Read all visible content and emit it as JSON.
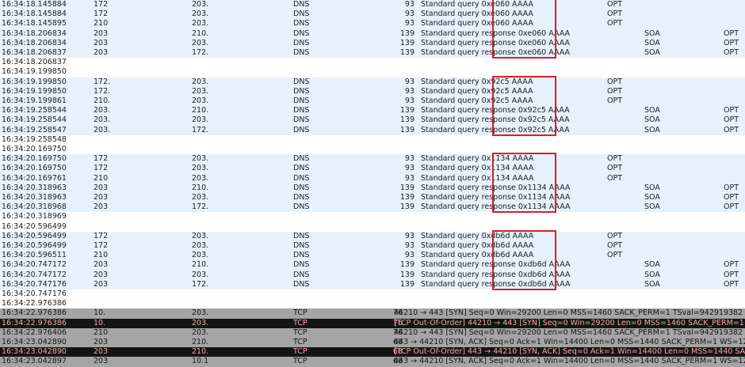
{
  "rows": [
    {
      "time": "16:34:18.145884",
      "src": "172",
      "dst": "203.",
      "proto": "DNS",
      "len": "93",
      "info": "Standard query 0xe060 AAAA",
      "rr1": "OPT",
      "rr2": "",
      "rr3": "",
      "style": "dns"
    },
    {
      "time": "16:34:18.145884",
      "src": "172",
      "dst": "203.",
      "proto": "DNS",
      "len": "93",
      "info": "Standard query 0xe060 AAAA",
      "rr1": "OPT",
      "rr2": "",
      "rr3": "",
      "style": "dns"
    },
    {
      "time": "16:34:18.145895",
      "src": "210",
      "dst": "203.",
      "proto": "DNS",
      "len": "93",
      "info": "Standard query 0xe060 AAAA",
      "rr1": "OPT",
      "rr2": "",
      "rr3": "",
      "style": "dns"
    },
    {
      "time": "16:34:18.206834",
      "src": "203",
      "dst": "210.",
      "proto": "DNS",
      "len": "139",
      "info": "Standard query response 0xe060 AAAA",
      "rr1": "",
      "rr2": "SOA",
      "rr3": "OPT",
      "style": "dns"
    },
    {
      "time": "16:34:18.206834",
      "src": "203",
      "dst": "203.",
      "proto": "DNS",
      "len": "139",
      "info": "Standard query response 0xe060 AAAA",
      "rr1": "",
      "rr2": "SOA",
      "rr3": "OPT",
      "style": "dns"
    },
    {
      "time": "16:34:18.206837",
      "src": "203",
      "dst": "172.",
      "proto": "DNS",
      "len": "139",
      "info": "Standard query response 0xe060 AAAA",
      "rr1": "",
      "rr2": "SOA",
      "rr3": "OPT",
      "style": "dns"
    },
    {
      "time": "16:34:18.206837",
      "src": "",
      "dst": "",
      "proto": "",
      "len": "",
      "info": "",
      "rr1": "",
      "rr2": "",
      "rr3": "",
      "style": "white"
    },
    {
      "time": "16:34:19.199850",
      "src": "",
      "dst": "",
      "proto": "",
      "len": "",
      "info": "",
      "rr1": "",
      "rr2": "",
      "rr3": "",
      "style": "white"
    },
    {
      "time": "16:34:19.199850",
      "src": "172.",
      "dst": "203.",
      "proto": "DNS",
      "len": "93",
      "info": "Standard query 0x92c5 AAAA",
      "rr1": "OPT",
      "rr2": "",
      "rr3": "",
      "style": "dns"
    },
    {
      "time": "16:34:19.199850",
      "src": "172.",
      "dst": "203.",
      "proto": "DNS",
      "len": "93",
      "info": "Standard query 0x92c5 AAAA",
      "rr1": "OPT",
      "rr2": "",
      "rr3": "",
      "style": "dns"
    },
    {
      "time": "16:34:19.199861",
      "src": "210.",
      "dst": "203.",
      "proto": "DNS",
      "len": "93",
      "info": "Standard query 0x92c5 AAAA",
      "rr1": "OPT",
      "rr2": "",
      "rr3": "",
      "style": "dns"
    },
    {
      "time": "16:34:19.258544",
      "src": "203.",
      "dst": "210.",
      "proto": "DNS",
      "len": "139",
      "info": "Standard query response 0x92c5 AAAA",
      "rr1": "",
      "rr2": "SOA",
      "rr3": "OPT",
      "style": "dns"
    },
    {
      "time": "16:34:19.258544",
      "src": "203.",
      "dst": "203.",
      "proto": "DNS",
      "len": "139",
      "info": "Standard query response 0x92c5 AAAA",
      "rr1": "",
      "rr2": "SOA",
      "rr3": "OPT",
      "style": "dns"
    },
    {
      "time": "16:34:19.258547",
      "src": "203.",
      "dst": "172.",
      "proto": "DNS",
      "len": "139",
      "info": "Standard query response 0x92c5 AAAA",
      "rr1": "",
      "rr2": "SOA",
      "rr3": "OPT",
      "style": "dns"
    },
    {
      "time": "16:34:19.258548",
      "src": "",
      "dst": "",
      "proto": "",
      "len": "",
      "info": "",
      "rr1": "",
      "rr2": "",
      "rr3": "",
      "style": "white"
    },
    {
      "time": "16:34:20.169750",
      "src": "",
      "dst": "",
      "proto": "",
      "len": "",
      "info": "",
      "rr1": "",
      "rr2": "",
      "rr3": "",
      "style": "white"
    },
    {
      "time": "16:34:20.169750",
      "src": "172",
      "dst": "203.",
      "proto": "DNS",
      "len": "93",
      "info": "Standard query 0x1134 AAAA",
      "rr1": "OPT",
      "rr2": "",
      "rr3": "",
      "style": "dns"
    },
    {
      "time": "16:34:20.169750",
      "src": "172",
      "dst": "203.",
      "proto": "DNS",
      "len": "93",
      "info": "Standard query 0x1134 AAAA",
      "rr1": "OPT",
      "rr2": "",
      "rr3": "",
      "style": "dns"
    },
    {
      "time": "16:34:20.169761",
      "src": "210",
      "dst": "203.",
      "proto": "DNS",
      "len": "93",
      "info": "Standard query 0x1134 AAAA",
      "rr1": "OPT",
      "rr2": "",
      "rr3": "",
      "style": "dns"
    },
    {
      "time": "16:34:20.318963",
      "src": "203",
      "dst": "210.",
      "proto": "DNS",
      "len": "139",
      "info": "Standard query response 0x1134 AAAA",
      "rr1": "",
      "rr2": "SOA",
      "rr3": "OPT",
      "style": "dns"
    },
    {
      "time": "16:34:20.318963",
      "src": "203",
      "dst": "203.",
      "proto": "DNS",
      "len": "139",
      "info": "Standard query response 0x1134 AAAA",
      "rr1": "",
      "rr2": "SOA",
      "rr3": "OPT",
      "style": "dns"
    },
    {
      "time": "16:34:20.318968",
      "src": "203",
      "dst": "172.",
      "proto": "DNS",
      "len": "139",
      "info": "Standard query response 0x1134 AAAA",
      "rr1": "",
      "rr2": "SOA",
      "rr3": "OPT",
      "style": "dns"
    },
    {
      "time": "16:34:20.318969",
      "src": "",
      "dst": "",
      "proto": "",
      "len": "",
      "info": "",
      "rr1": "",
      "rr2": "",
      "rr3": "",
      "style": "white"
    },
    {
      "time": "16:34:20.596499",
      "src": "",
      "dst": "",
      "proto": "",
      "len": "",
      "info": "",
      "rr1": "",
      "rr2": "",
      "rr3": "",
      "style": "white"
    },
    {
      "time": "16:34:20.596499",
      "src": "172",
      "dst": "203.",
      "proto": "DNS",
      "len": "93",
      "info": "Standard query 0xdb6d AAAA",
      "rr1": "OPT",
      "rr2": "",
      "rr3": "",
      "style": "dns"
    },
    {
      "time": "16:34:20.596499",
      "src": "172",
      "dst": "203.",
      "proto": "DNS",
      "len": "93",
      "info": "Standard query 0xdb6d AAAA",
      "rr1": "OPT",
      "rr2": "",
      "rr3": "",
      "style": "dns"
    },
    {
      "time": "16:34:20.596511",
      "src": "210",
      "dst": "203.",
      "proto": "DNS",
      "len": "93",
      "info": "Standard query 0xdb6d AAAA",
      "rr1": "OPT",
      "rr2": "",
      "rr3": "",
      "style": "dns"
    },
    {
      "time": "16:34:20.747172",
      "src": "203",
      "dst": "210.",
      "proto": "DNS",
      "len": "139",
      "info": "Standard query response 0xdb6d AAAA",
      "rr1": "",
      "rr2": "SOA",
      "rr3": "OPT",
      "style": "dns"
    },
    {
      "time": "16:34:20.747172",
      "src": "203",
      "dst": "203.",
      "proto": "DNS",
      "len": "139",
      "info": "Standard query response 0xdb6d AAAA",
      "rr1": "",
      "rr2": "SOA",
      "rr3": "OPT",
      "style": "dns"
    },
    {
      "time": "16:34:20.747176",
      "src": "203",
      "dst": "172.",
      "proto": "DNS",
      "len": "139",
      "info": "Standard query response 0xdb6d AAAA",
      "rr1": "",
      "rr2": "SOA",
      "rr3": "OPT",
      "style": "dns"
    },
    {
      "time": "16:34:20.747176",
      "src": "",
      "dst": "",
      "proto": "",
      "len": "",
      "info": "",
      "rr1": "",
      "rr2": "",
      "rr3": "",
      "style": "white"
    },
    {
      "time": "16:34:22.976386",
      "src": "",
      "dst": "",
      "proto": "",
      "len": "",
      "info": "",
      "rr1": "",
      "rr2": "",
      "rr3": "",
      "style": "white"
    },
    {
      "time": "16:34:22.976386",
      "src": "10.",
      "dst": "203.",
      "proto": "TCP",
      "len": "76",
      "info": "44210 → 443 [SYN] Seq=0 Win=29200 Len=0 MSS=1460 SACK_PERM=1 TSval=942919382 TSec",
      "rr1": "",
      "rr2": "",
      "rr3": "",
      "style": "tcp"
    },
    {
      "time": "16:34:22.976386",
      "src": "10.",
      "dst": "203.",
      "proto": "TCP",
      "len": "76",
      "info": "[TCP Out-Of-Order] 44210 → 443 [SYN] Seq=0 Win=29200 Len=0 MSS=1460 SACK_PERM=1 T",
      "rr1": "",
      "rr2": "",
      "rr3": "",
      "style": "dark"
    },
    {
      "time": "16:34:22.976406",
      "src": "210",
      "dst": "203.",
      "proto": "TCP",
      "len": "76",
      "info": "44210 → 443 [SYN] Seq=0 Win=29200 Len=0 MSS=1460 SACK_PERM=1 TSval=942919382 TS",
      "rr1": "",
      "rr2": "",
      "rr3": "",
      "style": "tcp"
    },
    {
      "time": "16:34:23.042890",
      "src": "203",
      "dst": "210.",
      "proto": "TCP",
      "len": "68",
      "info": "443 → 44210 [SYN, ACK] Seq=0 Ack=1 Win=14400 Len=0 MSS=1440 SACK_PERM=1 WS=128",
      "rr1": "",
      "rr2": "",
      "rr3": "",
      "style": "tcp"
    },
    {
      "time": "16:34:23.042890",
      "src": "203",
      "dst": "210.",
      "proto": "TCP",
      "len": "68",
      "info": "[TCP Out-Of-Order] 443 → 44210 [SYN, ACK] Seq=0 Ack=1 Win=14400 Len=0 MSS=1440 SA",
      "rr1": "",
      "rr2": "",
      "rr3": "",
      "style": "dark"
    },
    {
      "time": "16:34:23.042897",
      "src": "203",
      "dst": "10.1",
      "proto": "TCP",
      "len": "68",
      "info": "443 → 44210 [SYN, ACK] Seq=0 Ack=1 Win=14400 Len=0 MSS=1440 SACK_PERM=1 WS=128",
      "rr1": "",
      "rr2": "",
      "rr3": "",
      "style": "tcp"
    }
  ],
  "colors": {
    "dns_row": "#e6f1fb",
    "tcp_row": "#a5a5a5",
    "dark_row": "#141414",
    "dark_row_text": "#f2a8a8",
    "highlight_box": "#d61f2b"
  }
}
